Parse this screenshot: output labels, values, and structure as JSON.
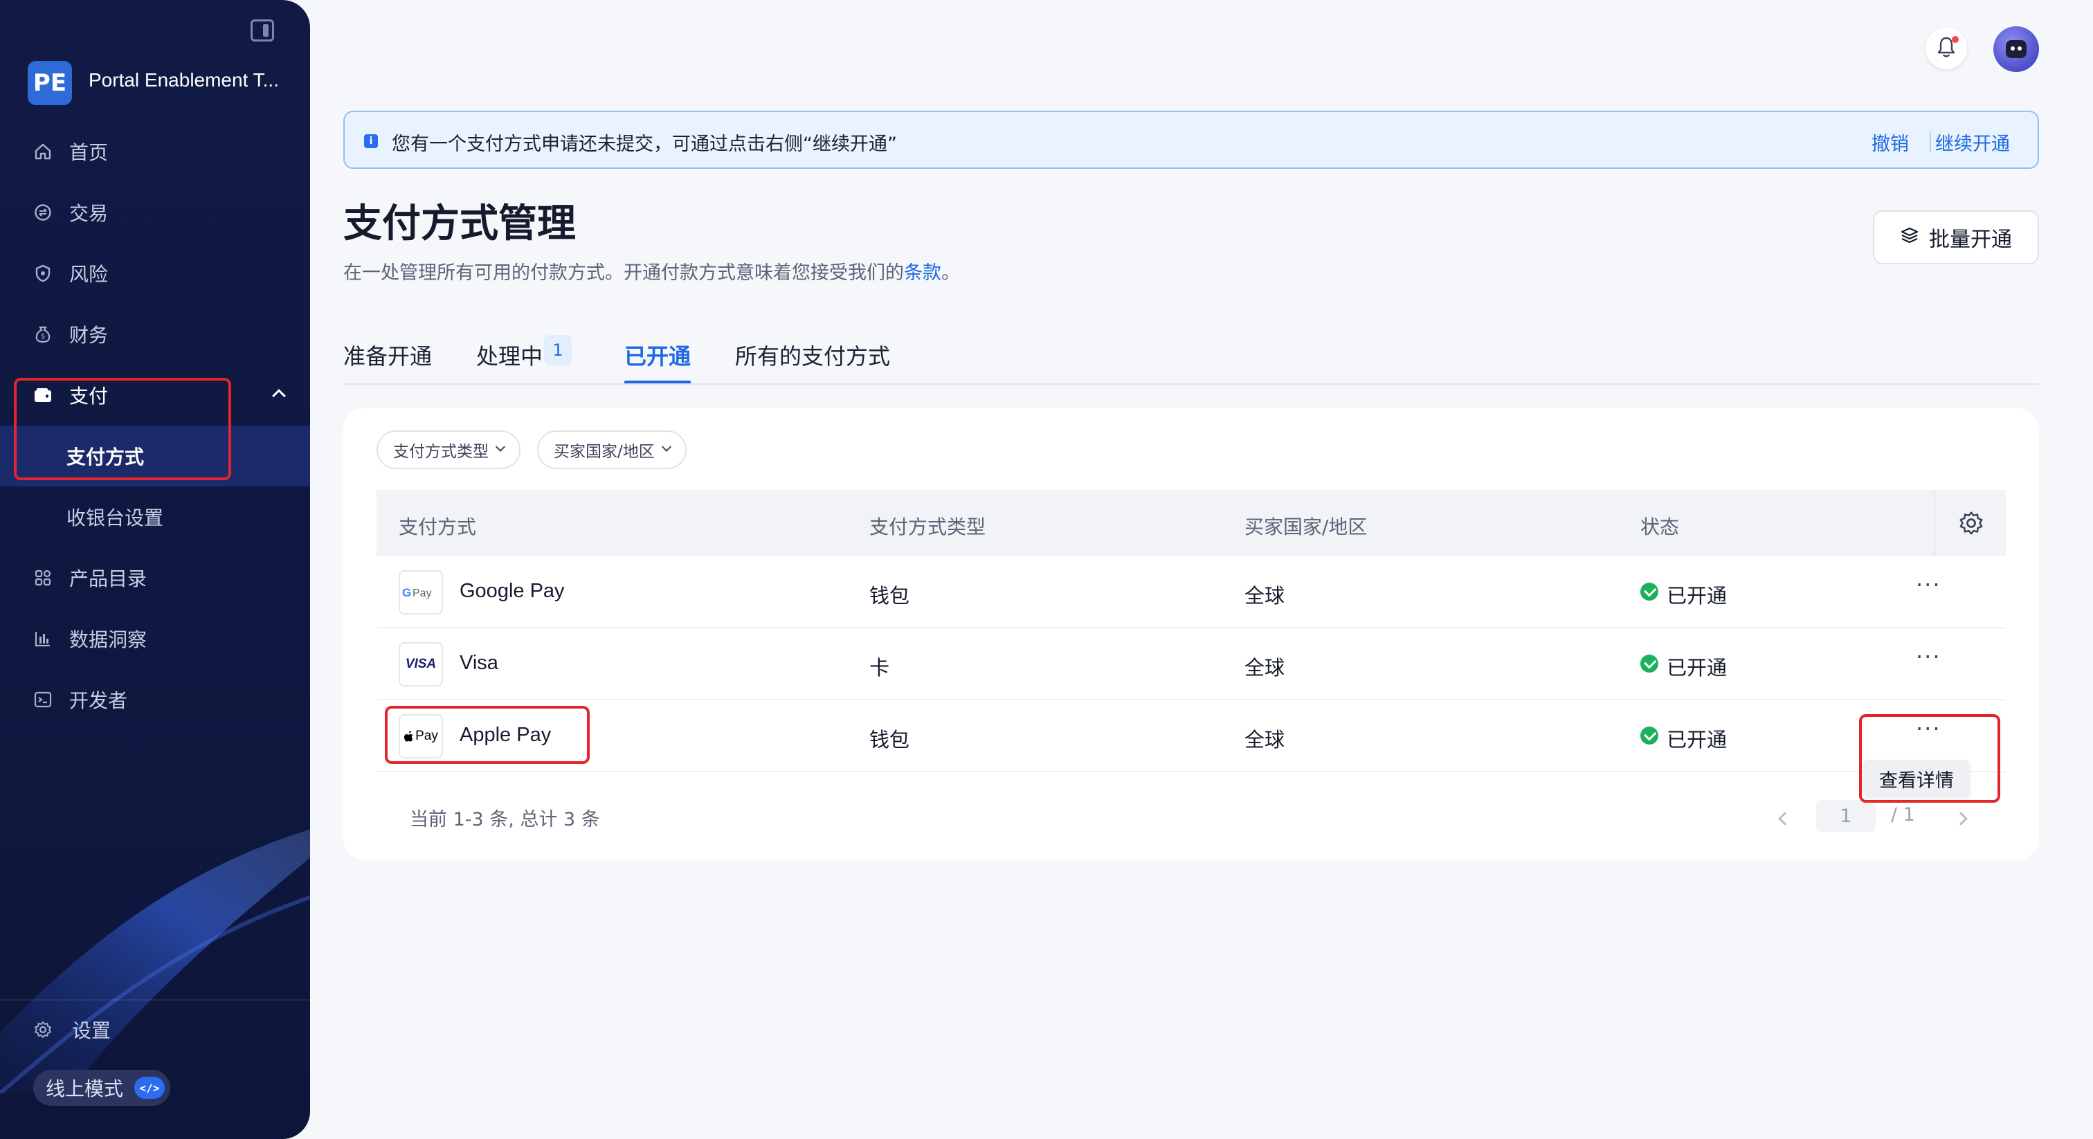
{
  "sidebar": {
    "brand_initials": "PE",
    "brand_name": "Portal Enablement T...",
    "items": [
      {
        "label": "首页",
        "icon": "home-icon"
      },
      {
        "label": "交易",
        "icon": "exchange-icon"
      },
      {
        "label": "风险",
        "icon": "shield-icon"
      },
      {
        "label": "财务",
        "icon": "money-bag-icon"
      },
      {
        "label": "支付",
        "icon": "wallet-icon"
      },
      {
        "label": "支付方式",
        "icon": ""
      },
      {
        "label": "收银台设置",
        "icon": ""
      },
      {
        "label": "产品目录",
        "icon": "grid-icon"
      },
      {
        "label": "数据洞察",
        "icon": "bar-chart-icon"
      },
      {
        "label": "开发者",
        "icon": "terminal-icon"
      }
    ],
    "settings_label": "设置",
    "mode_label": "线上模式",
    "mode_badge": "</>"
  },
  "notice": {
    "message": "您有一个支付方式申请还未提交，可通过点击右侧“继续开通”",
    "revoke": "撤销",
    "continue": "继续开通"
  },
  "header": {
    "title": "支付方式管理",
    "desc_prefix": "在一处管理所有可用的付款方式。开通付款方式意味着您接受我们的",
    "desc_link": "条款",
    "desc_suffix": "。",
    "batch_button": "批量开通"
  },
  "tabs": [
    {
      "label": "准备开通"
    },
    {
      "label": "处理中",
      "count": "1"
    },
    {
      "label": "已开通",
      "active": true
    },
    {
      "label": "所有的支付方式"
    }
  ],
  "filters": {
    "type": "支付方式类型",
    "country": "买家国家/地区"
  },
  "table": {
    "columns": [
      "支付方式",
      "支付方式类型",
      "买家国家/地区",
      "状态"
    ],
    "rows": [
      {
        "logo": "G Pay",
        "name": "Google Pay",
        "type": "钱包",
        "region": "全球",
        "status": "已开通"
      },
      {
        "logo": "VISA",
        "name": "Visa",
        "type": "卡",
        "region": "全球",
        "status": "已开通"
      },
      {
        "logo": "Pay",
        "name": "Apple Pay",
        "type": "钱包",
        "region": "全球",
        "status": "已开通"
      }
    ],
    "more_glyph": "···",
    "menu_item": "查看详情"
  },
  "pagination": {
    "info": "当前 1-3 条, 总计 3 条",
    "current_page": "1",
    "total_pages": "/ 1"
  },
  "colors": {
    "accent": "#1f6ae0",
    "sidebar_bg": "#111a45",
    "success": "#1bb15a",
    "highlight": "#e4252c"
  }
}
